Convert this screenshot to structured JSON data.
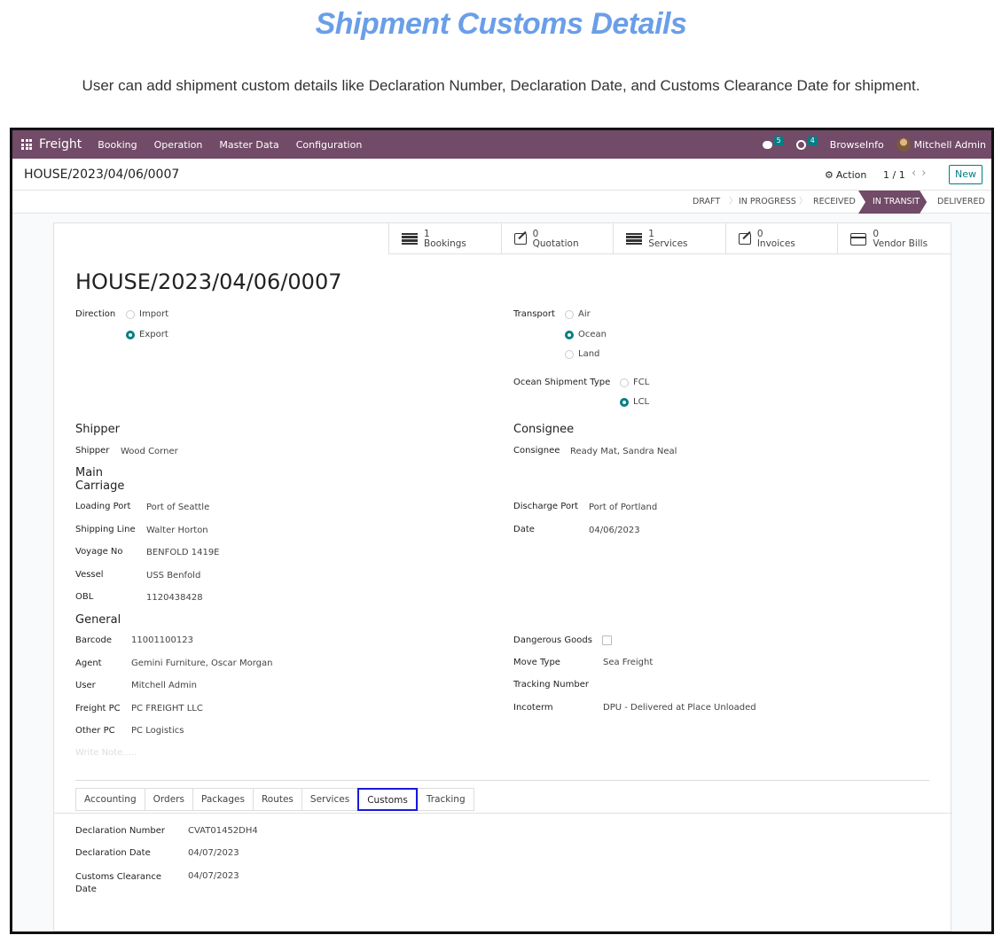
{
  "hero": {
    "title": "Shipment Customs Details",
    "subtitle": "User can add shipment custom details like Declaration Number, Declaration Date, and Customs Clearance Date for shipment."
  },
  "navbar": {
    "brand": "Freight",
    "menu": [
      "Booking",
      "Operation",
      "Master Data",
      "Configuration"
    ],
    "messages_count": "5",
    "activities_count": "4",
    "company": "BrowseInfo",
    "user": "Mitchell Admin"
  },
  "control": {
    "breadcrumb": "HOUSE/2023/04/06/0007",
    "action_label": "Action",
    "pager": "1 / 1",
    "new_label": "New"
  },
  "status": {
    "stages": [
      "DRAFT",
      "IN PROGRESS",
      "RECEIVED",
      "IN TRANSIT",
      "DELIVERED"
    ],
    "active": "IN TRANSIT"
  },
  "smart_buttons": [
    {
      "count": "1",
      "label": "Bookings",
      "icon": "list-icon"
    },
    {
      "count": "0",
      "label": "Quotation",
      "icon": "edit-icon"
    },
    {
      "count": "1",
      "label": "Services",
      "icon": "list-icon"
    },
    {
      "count": "0",
      "label": "Invoices",
      "icon": "edit-icon"
    },
    {
      "count": "0",
      "label": "Vendor Bills",
      "icon": "card-icon"
    }
  ],
  "record": {
    "title": "HOUSE/2023/04/06/0007",
    "direction": {
      "label": "Direction",
      "options": [
        "Import",
        "Export"
      ],
      "selected": "Export"
    },
    "transport": {
      "label": "Transport",
      "options": [
        "Air",
        "Ocean",
        "Land"
      ],
      "selected": "Ocean"
    },
    "ocean_type": {
      "label": "Ocean Shipment Type",
      "options": [
        "FCL",
        "LCL"
      ],
      "selected": "LCL"
    },
    "shipper_group": "Shipper",
    "shipper": {
      "label": "Shipper",
      "value": "Wood Corner"
    },
    "consignee_group": "Consignee",
    "consignee": {
      "label": "Consignee",
      "value": "Ready Mat, Sandra Neal"
    },
    "main_carriage_group": "Main Carriage",
    "loading_port": {
      "label": "Loading Port",
      "value": "Port of Seattle"
    },
    "shipping_line": {
      "label": "Shipping Line",
      "value": "Walter Horton"
    },
    "voyage_no": {
      "label": "Voyage No",
      "value": "BENFOLD 1419E"
    },
    "vessel": {
      "label": "Vessel",
      "value": "USS Benfold"
    },
    "obl": {
      "label": "OBL",
      "value": "1120438428"
    },
    "discharge_port": {
      "label": "Discharge Port",
      "value": "Port of Portland"
    },
    "date": {
      "label": "Date",
      "value": "04/06/2023"
    },
    "general_group": "General",
    "barcode": {
      "label": "Barcode",
      "value": "11001100123"
    },
    "agent": {
      "label": "Agent",
      "value": "Gemini Furniture, Oscar Morgan"
    },
    "user": {
      "label": "User",
      "value": "Mitchell Admin"
    },
    "freight_pc": {
      "label": "Freight PC",
      "value": "PC FREIGHT LLC"
    },
    "other_pc": {
      "label": "Other PC",
      "value": "PC Logistics"
    },
    "dangerous_goods": {
      "label": "Dangerous Goods",
      "checked": false
    },
    "move_type": {
      "label": "Move Type",
      "value": "Sea Freight"
    },
    "tracking_number": {
      "label": "Tracking Number",
      "value": ""
    },
    "incoterm": {
      "label": "Incoterm",
      "value": "DPU - Delivered at Place Unloaded"
    },
    "note_placeholder": "Write Note....."
  },
  "tabs": {
    "items": [
      "Accounting",
      "Orders",
      "Packages",
      "Routes",
      "Services",
      "Customs",
      "Tracking"
    ],
    "active": "Customs"
  },
  "customs": {
    "declaration_number": {
      "label": "Declaration Number",
      "value": "CVAT01452DH4"
    },
    "declaration_date": {
      "label": "Declaration Date",
      "value": "04/07/2023"
    },
    "clearance_date": {
      "label_line1": "Customs Clearance",
      "label_line2": "Date",
      "value": "04/07/2023"
    }
  },
  "colors": {
    "brand": "#714b67",
    "accent": "#017e84",
    "highlight": "#1a1adb",
    "hero": "#6a9ee8"
  }
}
